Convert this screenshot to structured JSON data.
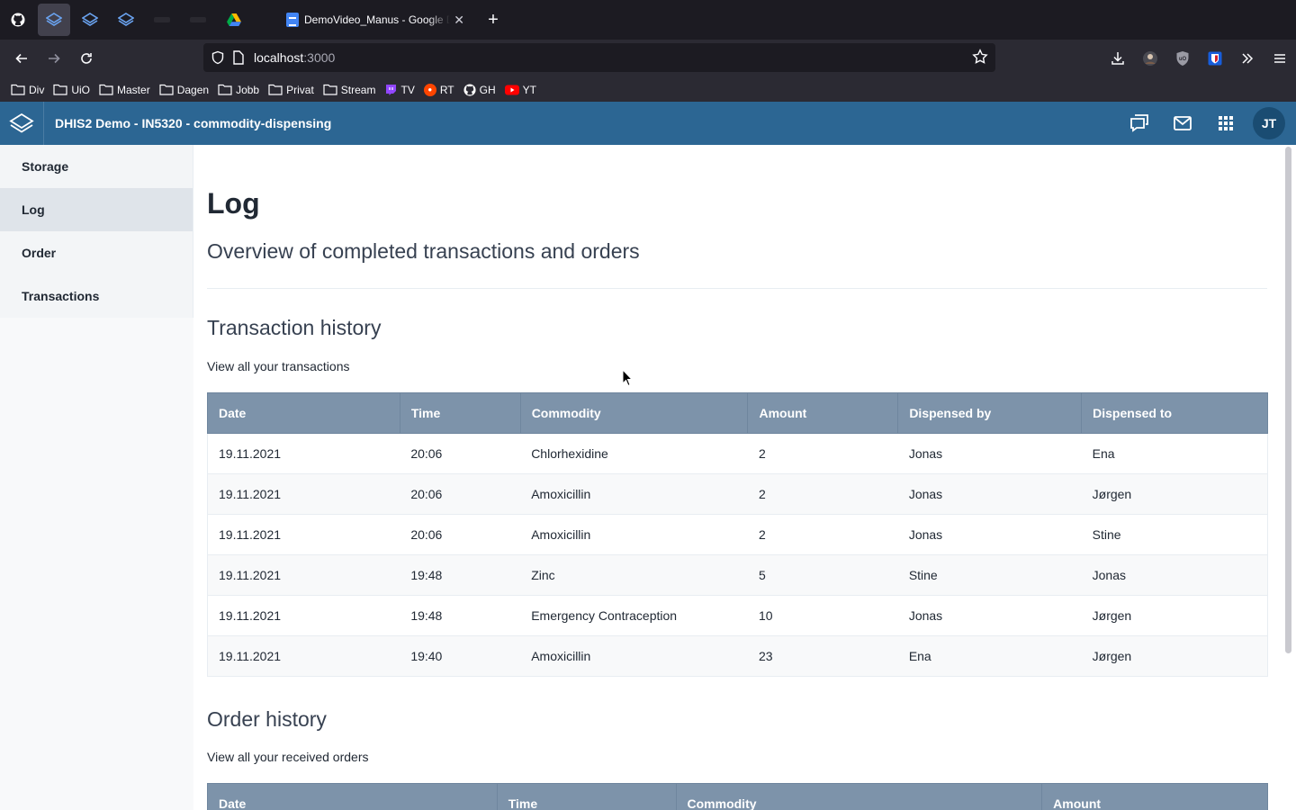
{
  "browser": {
    "tabs": {
      "doc_title": "DemoVideo_Manus - Google Docs"
    },
    "url": {
      "host": "localhost",
      "port": ":3000"
    },
    "bookmarks": [
      {
        "label": "Div",
        "icon": "folder-icon"
      },
      {
        "label": "UiO",
        "icon": "folder-icon"
      },
      {
        "label": "Master",
        "icon": "folder-icon"
      },
      {
        "label": "Dagen",
        "icon": "folder-icon"
      },
      {
        "label": "Jobb",
        "icon": "folder-icon"
      },
      {
        "label": "Privat",
        "icon": "folder-icon"
      },
      {
        "label": "Stream",
        "icon": "folder-icon"
      },
      {
        "label": "TV",
        "icon": "twitch-icon"
      },
      {
        "label": "RT",
        "icon": "reddit-icon"
      },
      {
        "label": "GH",
        "icon": "github-icon"
      },
      {
        "label": "YT",
        "icon": "youtube-icon"
      }
    ]
  },
  "header": {
    "app_title": "DHIS2 Demo - IN5320 - commodity-dispensing",
    "avatar_initials": "JT"
  },
  "sidebar": {
    "items": [
      {
        "label": "Storage"
      },
      {
        "label": "Log"
      },
      {
        "label": "Order"
      },
      {
        "label": "Transactions"
      }
    ],
    "active": "Log"
  },
  "main": {
    "title": "Log",
    "subtitle": "Overview of completed transactions and orders",
    "transactions": {
      "heading": "Transaction history",
      "description": "View all your transactions",
      "columns": [
        "Date",
        "Time",
        "Commodity",
        "Amount",
        "Dispensed by",
        "Dispensed to"
      ],
      "rows": [
        [
          "19.11.2021",
          "20:06",
          "Chlorhexidine",
          "2",
          "Jonas",
          "Ena"
        ],
        [
          "19.11.2021",
          "20:06",
          "Amoxicillin",
          "2",
          "Jonas",
          "Jørgen"
        ],
        [
          "19.11.2021",
          "20:06",
          "Amoxicillin",
          "2",
          "Jonas",
          "Stine"
        ],
        [
          "19.11.2021",
          "19:48",
          "Zinc",
          "5",
          "Stine",
          "Jonas"
        ],
        [
          "19.11.2021",
          "19:48",
          "Emergency Contraception",
          "10",
          "Jonas",
          "Jørgen"
        ],
        [
          "19.11.2021",
          "19:40",
          "Amoxicillin",
          "23",
          "Ena",
          "Jørgen"
        ]
      ]
    },
    "orders": {
      "heading": "Order history",
      "description": "View all your received orders",
      "columns": [
        "Date",
        "Time",
        "Commodity",
        "Amount"
      ]
    }
  },
  "colors": {
    "header_blue": "#2c6693",
    "table_header": "#7d93aa",
    "sidebar_active": "#dfe4ea"
  }
}
